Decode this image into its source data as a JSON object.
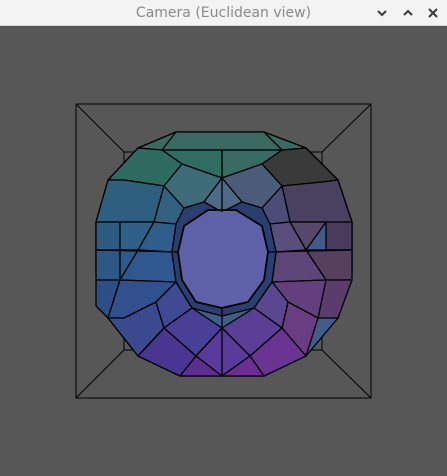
{
  "window": {
    "title": "Camera (Euclidean view)",
    "buttons": [
      "minimize",
      "maximize",
      "close"
    ]
  },
  "scene": {
    "background": "#575757",
    "icons": {
      "minimize": "chevron-down-icon",
      "maximize": "chevron-up-icon",
      "close": "close-icon"
    },
    "colors": {
      "top": "#3a7a6e",
      "left": "#2f5f8c",
      "right": "#5a4a70",
      "bottom": "#6a2f8e",
      "front_face": "#5e5fa6",
      "edge": "#000000",
      "box": "#000000"
    }
  }
}
